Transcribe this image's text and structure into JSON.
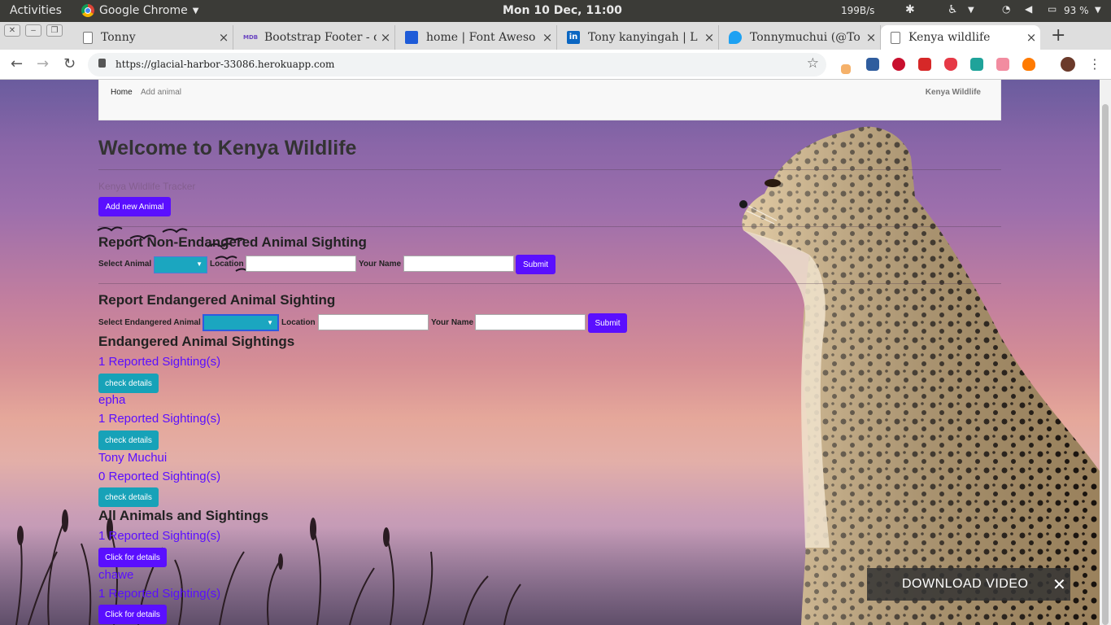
{
  "topbar": {
    "activities": "Activities",
    "app": "Google Chrome",
    "clock": "Mon 10 Dec, 11:00",
    "net": "199B/s",
    "battery": "93 %"
  },
  "tabs": [
    {
      "title": "Tonny",
      "favicon": "page-icon",
      "color": "#9e9e9e"
    },
    {
      "title": "Bootstrap Footer - c",
      "favicon": "mdb-icon",
      "color": "#6b46c1"
    },
    {
      "title": "home | Font Aweso",
      "favicon": "flag-icon",
      "color": "#1e5bd8"
    },
    {
      "title": "Tony kanyingah | L",
      "favicon": "linkedin-icon",
      "color": "#0a66c2"
    },
    {
      "title": "Tonnymuchui (@To",
      "favicon": "twitter-icon",
      "color": "#1da1f2"
    },
    {
      "title": "Kenya wildlife",
      "favicon": "page-icon",
      "color": "#9e9e9e"
    }
  ],
  "url": "https://glacial-harbor-33086.herokuapp.com",
  "nav": {
    "home": "Home",
    "add": "Add animal",
    "brand": "Kenya Wildlife"
  },
  "welcome": "Welcome to Kenya Wildlife",
  "subtitle": "Kenya Wildlife Tracker",
  "add_btn": "Add new Animal",
  "nonend": {
    "title": "Report Non-Endangered Animal Sighting",
    "select_label": "Select Animal",
    "location_label": "Location",
    "name_label": "Your Name",
    "submit": "Submit"
  },
  "end": {
    "title": "Report Endangered Animal Sighting",
    "select_label": "Select Endangered Animal",
    "location_label": "Location",
    "name_label": "Your Name",
    "submit": "Submit"
  },
  "end_sightings": {
    "title": "Endangered Animal Sightings",
    "items": [
      {
        "name": "",
        "count": "1 Reported Sighting(s)",
        "btn": "check details"
      },
      {
        "name": "epha",
        "count": "1 Reported Sighting(s)",
        "btn": "check details"
      },
      {
        "name": "Tony Muchui",
        "count": "0 Reported Sighting(s)",
        "btn": "check details"
      }
    ]
  },
  "all": {
    "title": "All Animals and Sightings",
    "items": [
      {
        "name": "",
        "count": "1 Reported Sighting(s)",
        "btn": "Click for details"
      },
      {
        "name": "chawe",
        "count": "1 Reported Sighting(s)",
        "btn": "Click for details"
      }
    ]
  },
  "download": "DOWNLOAD VIDEO"
}
